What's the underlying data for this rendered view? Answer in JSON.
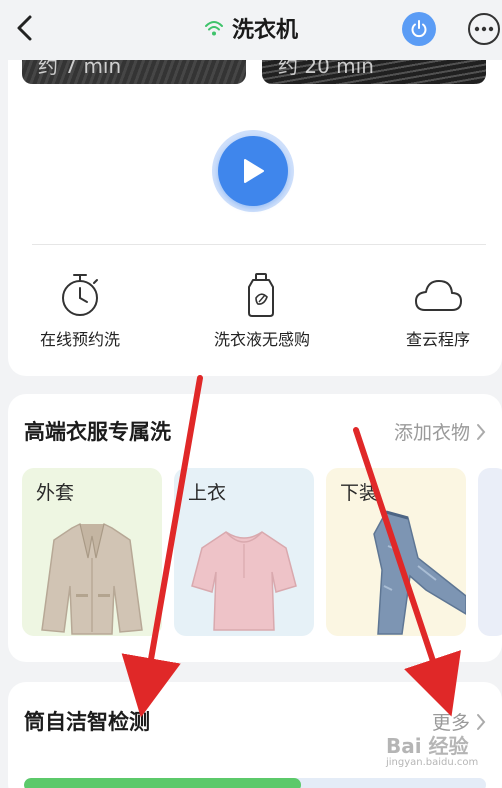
{
  "header": {
    "title": "洗衣机",
    "back_icon": "chevron-left-icon",
    "wifi_icon": "wifi-icon",
    "power_icon": "power-icon",
    "more_icon": "more-icon",
    "accent_color": "#5b9cf5",
    "wifi_color": "#3fc36b"
  },
  "programs": [
    {
      "label": "约 7 min"
    },
    {
      "label": "约 20 min"
    }
  ],
  "start": {
    "icon": "play-icon",
    "color": "#3f86ec"
  },
  "features": [
    {
      "label": "在线预约洗",
      "icon": "timer-icon"
    },
    {
      "label": "洗衣液无感购",
      "icon": "detergent-bottle-icon"
    },
    {
      "label": "查云程序",
      "icon": "cloud-icon"
    }
  ],
  "premium_wash": {
    "title": "高端衣服专属洗",
    "link": "添加衣物",
    "items": [
      {
        "label": "外套",
        "bg": "#eef6e2"
      },
      {
        "label": "上衣",
        "bg": "#e6f1f7"
      },
      {
        "label": "下装",
        "bg": "#fbf6e2"
      }
    ]
  },
  "self_clean": {
    "title": "筒自洁智检测",
    "link": "更多",
    "progress": 0.6
  },
  "watermark": {
    "text": "Bai 经验",
    "sub": "jingyan.baidu.com"
  }
}
